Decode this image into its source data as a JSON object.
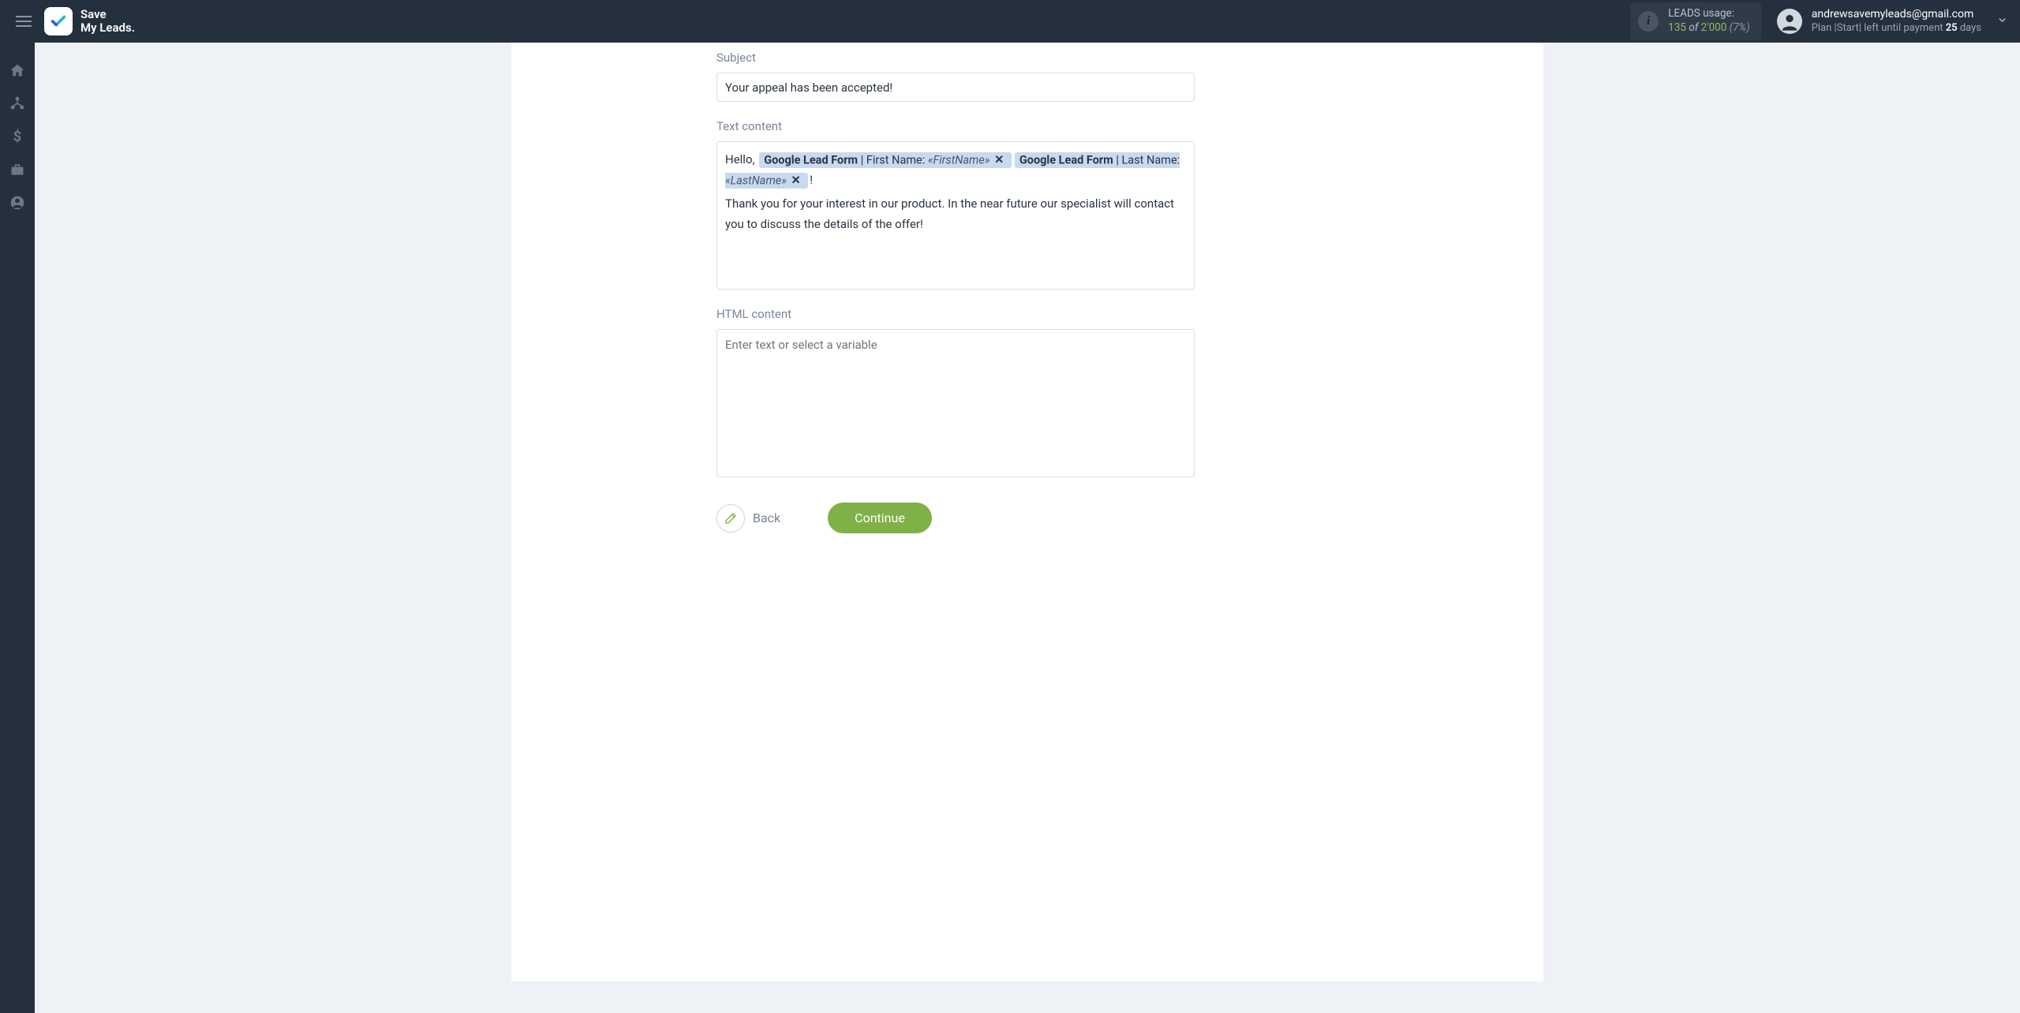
{
  "header": {
    "logo_line1": "Save",
    "logo_line2": "My Leads.",
    "leads_label": "LEADS usage:",
    "leads_used": "135",
    "leads_of": "of",
    "leads_total": "2'000",
    "leads_pct": "(7%)",
    "user_email": "andrewsavemyleads@gmail.com",
    "plan_prefix": "Plan |Start| left until payment ",
    "plan_days_num": "25",
    "plan_days_suffix": " days"
  },
  "form": {
    "subject_label": "Subject",
    "subject_value": "Your appeal has been accepted!",
    "text_label": "Text content",
    "text_hello": "Hello,",
    "tag1_source": "Google Lead Form",
    "tag1_field": "First Name:",
    "tag1_var": "«FirstName»",
    "tag2_source": "Google Lead Form",
    "tag2_field": "Last Name:",
    "tag2_var": "«LastName»",
    "text_exclaim": "!",
    "text_body": "Thank you for your interest in our product. In the near future our specialist will contact you to discuss the details of the offer!",
    "html_label": "HTML content",
    "html_placeholder": "Enter text or select a variable"
  },
  "actions": {
    "back": "Back",
    "continue": "Continue"
  }
}
